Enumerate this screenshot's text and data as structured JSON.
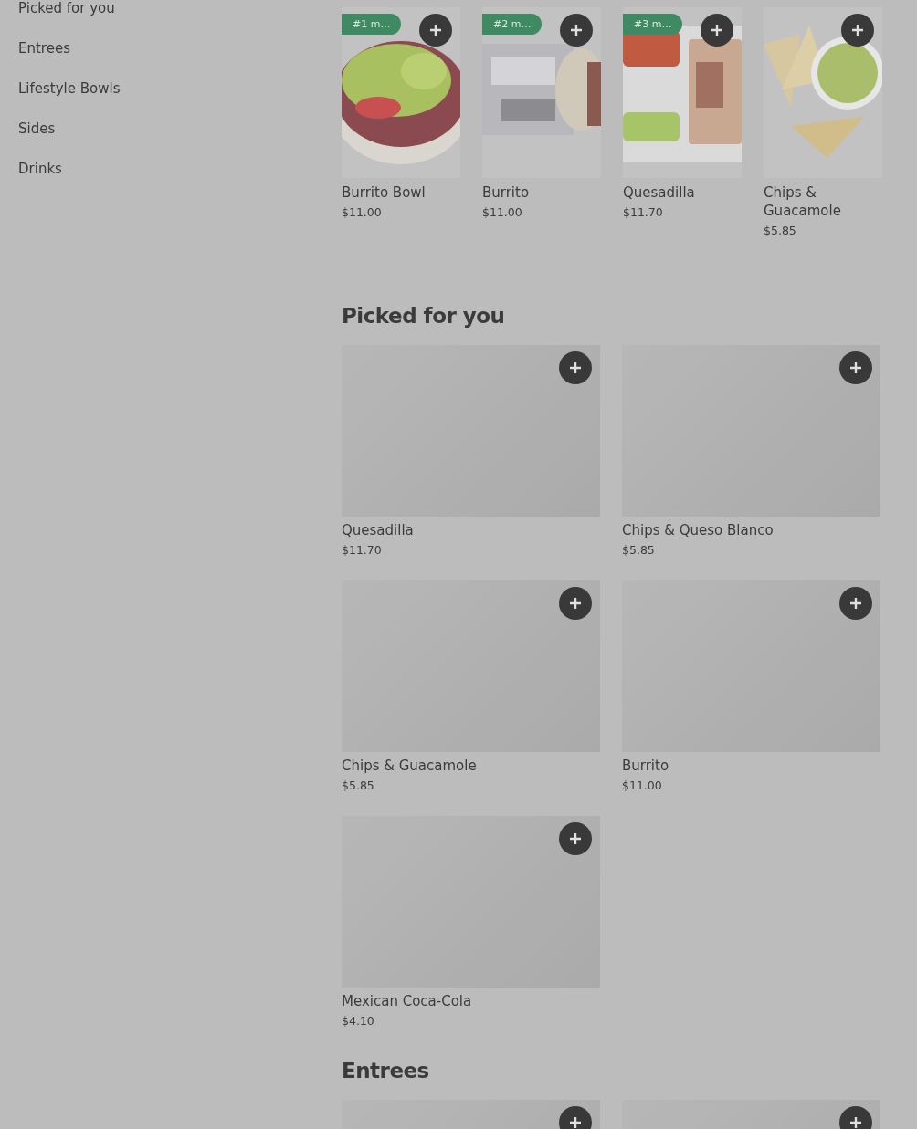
{
  "sidebar": {
    "items": [
      {
        "label": "Picked for you"
      },
      {
        "label": "Entrees"
      },
      {
        "label": "Lifestyle Bowls"
      },
      {
        "label": "Sides"
      },
      {
        "label": "Drinks"
      }
    ]
  },
  "carousel": {
    "items": [
      {
        "badge": "#1 m…",
        "name": "Burrito Bowl",
        "price": "$11.00"
      },
      {
        "badge": "#2 m…",
        "name": "Burrito",
        "price": "$11.00"
      },
      {
        "badge": "#3 m…",
        "name": "Quesadilla",
        "price": "$11.70"
      },
      {
        "name": "Chips & Guacamole",
        "price": "$5.85"
      }
    ]
  },
  "sections": [
    {
      "title": "Picked for you",
      "items": [
        {
          "kind": "placeholder",
          "name": "Quesadilla",
          "price": "$11.70"
        },
        {
          "kind": "placeholder",
          "name": "Chips & Queso Blanco",
          "price": "$5.85"
        },
        {
          "kind": "placeholder",
          "name": "Chips & Guacamole",
          "price": "$5.85"
        },
        {
          "kind": "placeholder",
          "name": "Burrito",
          "price": "$11.00"
        },
        {
          "kind": "placeholder",
          "name": "Mexican Coca-Cola",
          "price": "$4.10"
        }
      ]
    },
    {
      "title": "Entrees",
      "items": [
        {
          "kind": "placeholder"
        },
        {
          "kind": "placeholder"
        }
      ]
    }
  ]
}
